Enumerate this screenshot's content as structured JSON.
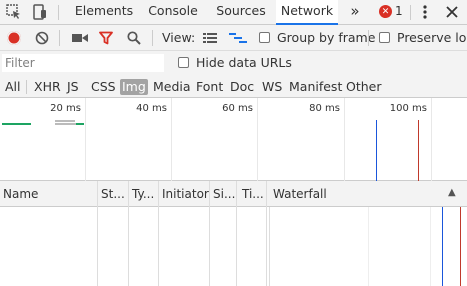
{
  "tabs": {
    "elements": "Elements",
    "console": "Console",
    "sources": "Sources",
    "network": "Network",
    "more": "»",
    "error_count": "1"
  },
  "toolbar": {
    "view_label": "View:",
    "group_by_frame": "Group by frame",
    "preserve_log": "Preserve log"
  },
  "filter": {
    "placeholder": "Filter",
    "hide_data_urls": "Hide data URLs"
  },
  "types": [
    "All",
    "XHR",
    "JS",
    "CSS",
    "Img",
    "Media",
    "Font",
    "Doc",
    "WS",
    "Manifest",
    "Other"
  ],
  "active_type": "Img",
  "overview": {
    "ticks": [
      "20 ms",
      "40 ms",
      "60 ms",
      "80 ms",
      "100 ms"
    ]
  },
  "table": {
    "columns": [
      "Name",
      "St...",
      "Ty...",
      "Initiator",
      "Si...",
      "Ti...",
      "Waterfall"
    ],
    "sort_indicator": "▲"
  },
  "colors": {
    "accent": "#1a73e8",
    "record": "#d93025",
    "dom_content_loaded": "#1a56db",
    "load": "#c0392b",
    "bar_green": "#1da462"
  }
}
